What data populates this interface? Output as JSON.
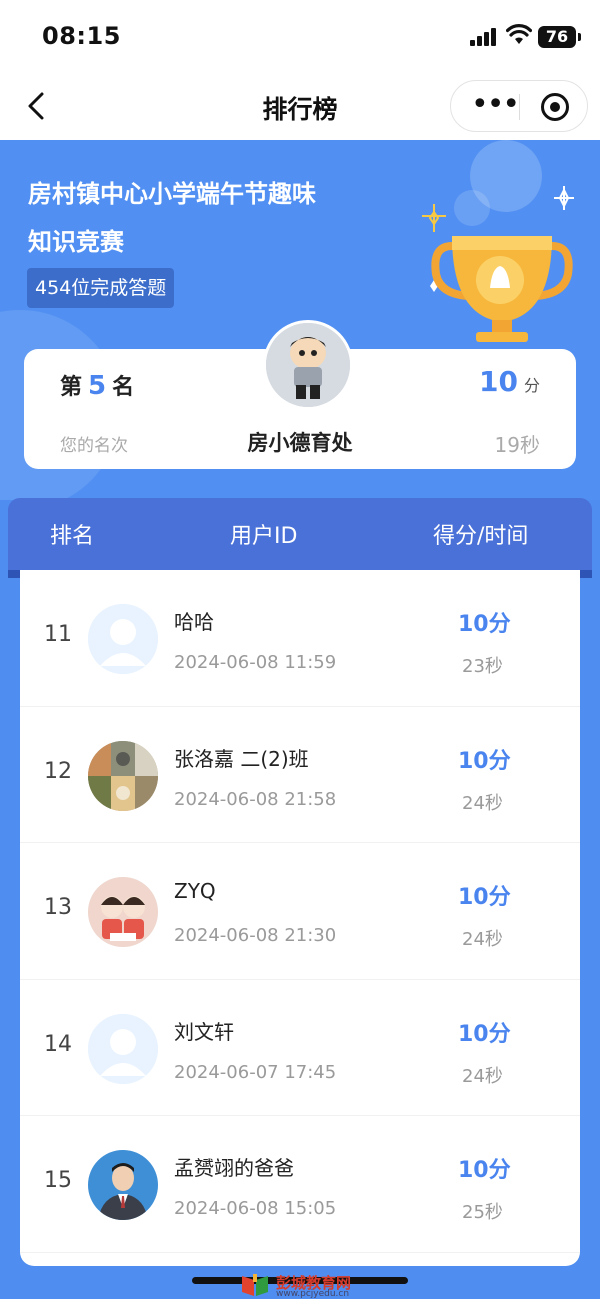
{
  "status_bar": {
    "time": "08:15",
    "battery": "76"
  },
  "nav": {
    "title": "排行榜",
    "more_icon": "ellipsis-icon",
    "close_icon": "target-icon"
  },
  "banner": {
    "quiz_title_line1": "房村镇中心小学端午节趣味",
    "quiz_title_line2": "知识竞赛",
    "completed_badge": "454位完成答题"
  },
  "my_rank": {
    "prefix": "第",
    "rank": "5",
    "suffix": "名",
    "subtitle": "您的名次",
    "name": "房小德育处",
    "score": "10",
    "score_unit": "分",
    "time": "19秒"
  },
  "table_header": {
    "rank": "排名",
    "user": "用户ID",
    "score_time": "得分/时间"
  },
  "rows": [
    {
      "rank": "11",
      "name": "哈哈",
      "date": "2024-06-08 11:59",
      "score": "10分",
      "time": "23秒",
      "avatar": "default"
    },
    {
      "rank": "12",
      "name": "张洛嘉 二(2)班",
      "date": "2024-06-08 21:58",
      "score": "10分",
      "time": "24秒",
      "avatar": "pets"
    },
    {
      "rank": "13",
      "name": "ZYQ",
      "date": "2024-06-08 21:30",
      "score": "10分",
      "time": "24秒",
      "avatar": "cartoon"
    },
    {
      "rank": "14",
      "name": "刘文轩",
      "date": "2024-06-07 17:45",
      "score": "10分",
      "time": "24秒",
      "avatar": "default"
    },
    {
      "rank": "15",
      "name": "孟赟翊的爸爸",
      "date": "2024-06-08 15:05",
      "score": "10分",
      "time": "25秒",
      "avatar": "photo"
    }
  ],
  "watermark": {
    "text": "彭城教育网",
    "url": "www.pcjyedu.cn"
  },
  "colors": {
    "accent": "#4a84ee",
    "banner": "#5190f2",
    "header": "#4a71d8"
  }
}
